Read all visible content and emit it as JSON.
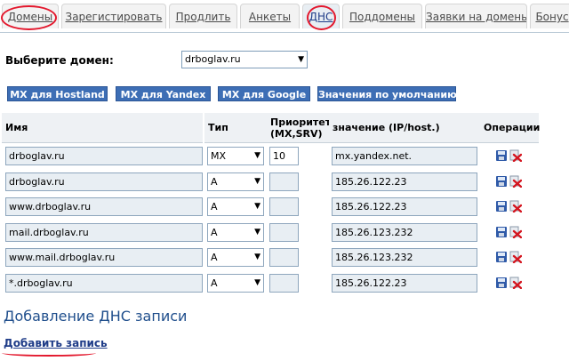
{
  "tabs": [
    {
      "label": "Домены"
    },
    {
      "label": "Зарегистировать"
    },
    {
      "label": "Продлить"
    },
    {
      "label": "Анкеты"
    },
    {
      "label": "ДНС"
    },
    {
      "label": "Поддомены"
    },
    {
      "label": "Заявки на домены"
    },
    {
      "label": "Бонус"
    }
  ],
  "domain_select": {
    "label": "Выберите домен:",
    "value": "drboglav.ru"
  },
  "buttons": [
    "MX для Hostland",
    "MX для Yandex",
    "MX для Google",
    "Значения по умолчанию"
  ],
  "table": {
    "headers": {
      "name": "Имя",
      "type": "Тип",
      "priority": "Приоритет (MX,SRV)",
      "value": "значение (IP/host.)",
      "ops": "Операции"
    },
    "rows": [
      {
        "name": "drboglav.ru",
        "type": "MX",
        "priority": "10",
        "value": "mx.yandex.net."
      },
      {
        "name": "drboglav.ru",
        "type": "A",
        "priority": "",
        "value": "185.26.122.23"
      },
      {
        "name": "www.drboglav.ru",
        "type": "A",
        "priority": "",
        "value": "185.26.122.23"
      },
      {
        "name": "mail.drboglav.ru",
        "type": "A",
        "priority": "",
        "value": "185.26.123.232"
      },
      {
        "name": "www.mail.drboglav.ru",
        "type": "A",
        "priority": "",
        "value": "185.26.123.232"
      },
      {
        "name": "*.drboglav.ru",
        "type": "A",
        "priority": "",
        "value": "185.26.122.23"
      }
    ]
  },
  "section_title": "Добавление ДНС записи",
  "add_link": "Добавить запись",
  "colors": {
    "accent": "#3d6eb5",
    "annotation": "#e3182d"
  },
  "icons": {
    "save": "floppy-disk",
    "delete": "red-x"
  }
}
